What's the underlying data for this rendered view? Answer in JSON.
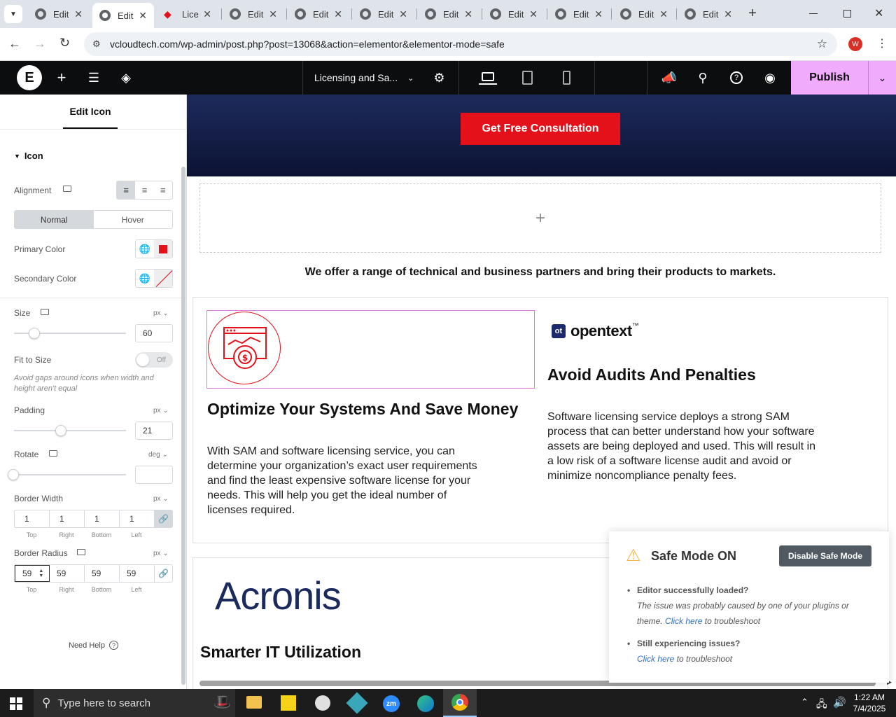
{
  "browser": {
    "tabs": [
      {
        "label": "Edit"
      },
      {
        "label": "Edit"
      },
      {
        "label": "Lice"
      },
      {
        "label": "Edit"
      },
      {
        "label": "Edit"
      },
      {
        "label": "Edit"
      },
      {
        "label": "Edit"
      },
      {
        "label": "Edit"
      },
      {
        "label": "Edit"
      },
      {
        "label": "Edit"
      },
      {
        "label": "Edit"
      }
    ],
    "url": "vcloudtech.com/wp-admin/post.php?post=13068&action=elementor&elementor-mode=safe",
    "profile_initial": "W"
  },
  "editor": {
    "page_title": "Licensing and Sa...",
    "publish_label": "Publish"
  },
  "panel": {
    "header_tab": "Edit Icon",
    "section_title": "Icon",
    "alignment_label": "Alignment",
    "state_tabs": {
      "normal": "Normal",
      "hover": "Hover"
    },
    "primary_color_label": "Primary Color",
    "primary_color": "#e4111b",
    "secondary_color_label": "Secondary Color",
    "size_label": "Size",
    "size_unit": "px",
    "size_value": "60",
    "fit_to_size_label": "Fit to Size",
    "fit_toggle": "Off",
    "fit_help": "Avoid gaps around icons when width and height aren't equal",
    "padding_label": "Padding",
    "padding_unit": "px",
    "padding_value": "21",
    "rotate_label": "Rotate",
    "rotate_unit": "deg",
    "border_width_label": "Border Width",
    "border_width_unit": "px",
    "border_width": [
      "1",
      "1",
      "1",
      "1"
    ],
    "border_radius_label": "Border Radius",
    "border_radius_unit": "px",
    "border_radius": [
      "59",
      "59",
      "59",
      "59"
    ],
    "side_labels": [
      "Top",
      "Right",
      "Bottom",
      "Left"
    ],
    "need_help": "Need Help"
  },
  "canvas": {
    "cta_button": "Get Free Consultation",
    "partners_text": "We offer a range of technical and business partners and bring their products to markets.",
    "card1_title": "Optimize Your Systems And Save Money",
    "card1_body": "With SAM and software licensing service, you can determine your organization’s exact user requirements and find the least expensive software license for your needs. This will help you get the ideal number of licenses required.",
    "card2_logo": "opentext",
    "card2_logo_tm": "™",
    "card2_logo_mark": "ot",
    "card2_title": "Avoid Audits And Penalties",
    "card2_body": "Software licensing service deploys a strong SAM process that can better understand how your software assets are being deployed and used. This will result in a low risk of a software license audit and avoid or minimize noncompliance penalty fees.",
    "card3_logo": "Acronis",
    "card3_title": "Smarter IT Utilization"
  },
  "safe_mode": {
    "title": "Safe Mode ON",
    "button": "Disable Safe Mode",
    "item1_head": "Editor successfully loaded?",
    "item1_text": "The issue was probably caused by one of your plugins or theme.",
    "item1_link": "Click here",
    "item1_tail": "to troubleshoot",
    "item2_head": "Still experiencing issues?",
    "item2_link": "Click here",
    "item2_tail": "to troubleshoot"
  },
  "taskbar": {
    "search_placeholder": "Type here to search",
    "time": "1:22 AM",
    "date": "7/4/2025"
  },
  "colors": {
    "accent_red": "#e4111b",
    "publish_bg": "#f0abfc",
    "navy_header": "#101c44"
  }
}
